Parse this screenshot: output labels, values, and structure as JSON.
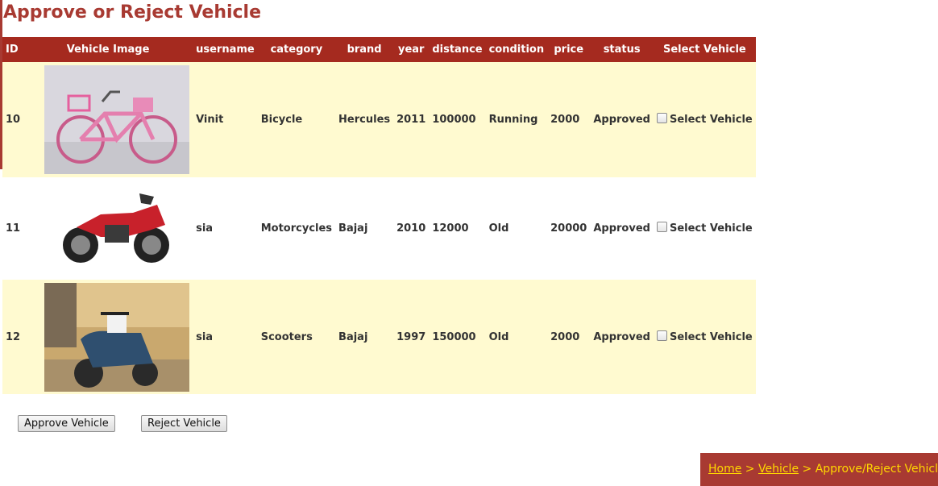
{
  "page": {
    "title": "Approve or Reject Vehicle"
  },
  "table": {
    "headers": [
      "ID",
      "Vehicle Image",
      "username",
      "category",
      "brand",
      "year",
      "distance",
      "condition",
      "price",
      "status",
      "Select Vehicle"
    ],
    "rows": [
      {
        "id": "10",
        "image": "pink-bicycle",
        "username": "Vinit",
        "category": "Bicycle",
        "brand": "Hercules",
        "year": "2011",
        "distance": "100000",
        "condition": "Running",
        "price": "2000",
        "status": "Approved",
        "select_label": "Select Vehicle"
      },
      {
        "id": "11",
        "image": "red-motorcycle",
        "username": "sia",
        "category": "Motorcycles",
        "brand": "Bajaj",
        "year": "2010",
        "distance": "12000",
        "condition": "Old",
        "price": "20000",
        "status": "Approved",
        "select_label": "Select Vehicle"
      },
      {
        "id": "12",
        "image": "blue-scooter",
        "username": "sia",
        "category": "Scooters",
        "brand": "Bajaj",
        "year": "1997",
        "distance": "150000",
        "condition": "Old",
        "price": "2000",
        "status": "Approved",
        "select_label": "Select Vehicle"
      }
    ]
  },
  "buttons": {
    "approve": "Approve Vehicle",
    "reject": "Reject Vehicle"
  },
  "breadcrumb": {
    "home": "Home",
    "sep": ">",
    "vehicle": "Vehicle",
    "current": "Approve/Reject Vehicle"
  },
  "colors": {
    "accent": "#a83a32",
    "header_bg": "#a52a1f",
    "row_alt": "#fffad0",
    "breadcrumb_link": "#ffd700"
  }
}
